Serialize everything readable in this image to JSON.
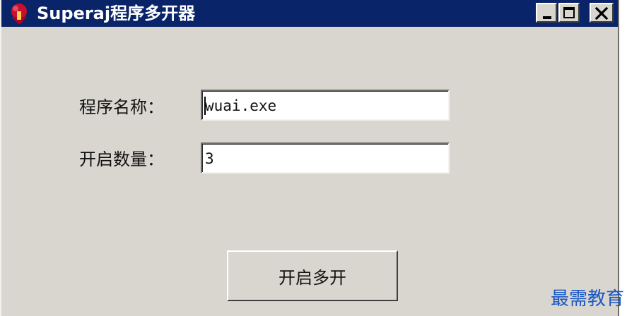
{
  "window": {
    "title": "Superaj程序多开器",
    "accent_color": "#0a246a",
    "background_color": "#d9d6d0",
    "controls": [
      "minimize-icon",
      "maximize-icon",
      "close-icon"
    ]
  },
  "form": {
    "program_name_label": "程序名称：",
    "program_name_value": "wuai.exe",
    "instance_count_label": "开启数量：",
    "instance_count_value": "3"
  },
  "actions": {
    "start_label": "开启多开"
  },
  "watermark": {
    "text": "最需教育",
    "color": "#1a57c4"
  }
}
